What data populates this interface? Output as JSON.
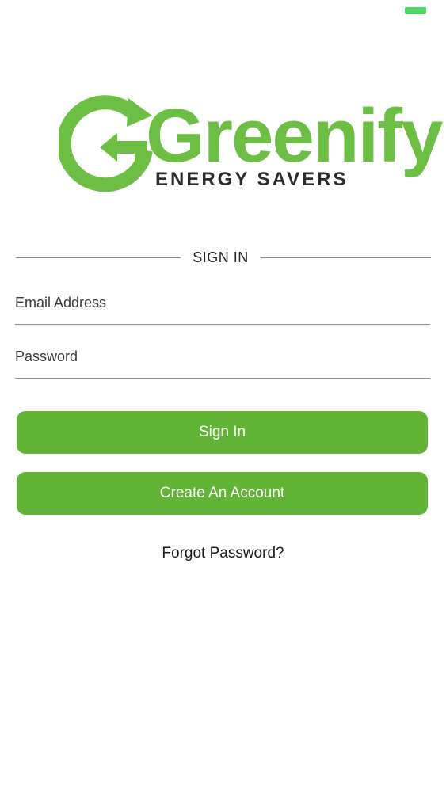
{
  "status_bar": {
    "battery_color": "#4cd964"
  },
  "logo": {
    "brand_name": "Greenify",
    "tagline": "ENERGY SAVERS",
    "brand_color": "#6cbf44",
    "icon": "recycle-arrows-icon"
  },
  "sign_in_heading": "SIGN IN",
  "form": {
    "email_placeholder": "Email Address",
    "email_value": "",
    "password_placeholder": "Password",
    "password_value": ""
  },
  "buttons": {
    "sign_in_label": "Sign In",
    "create_account_label": "Create An Account",
    "color": "#62b437"
  },
  "forgot_password_label": "Forgot Password?"
}
